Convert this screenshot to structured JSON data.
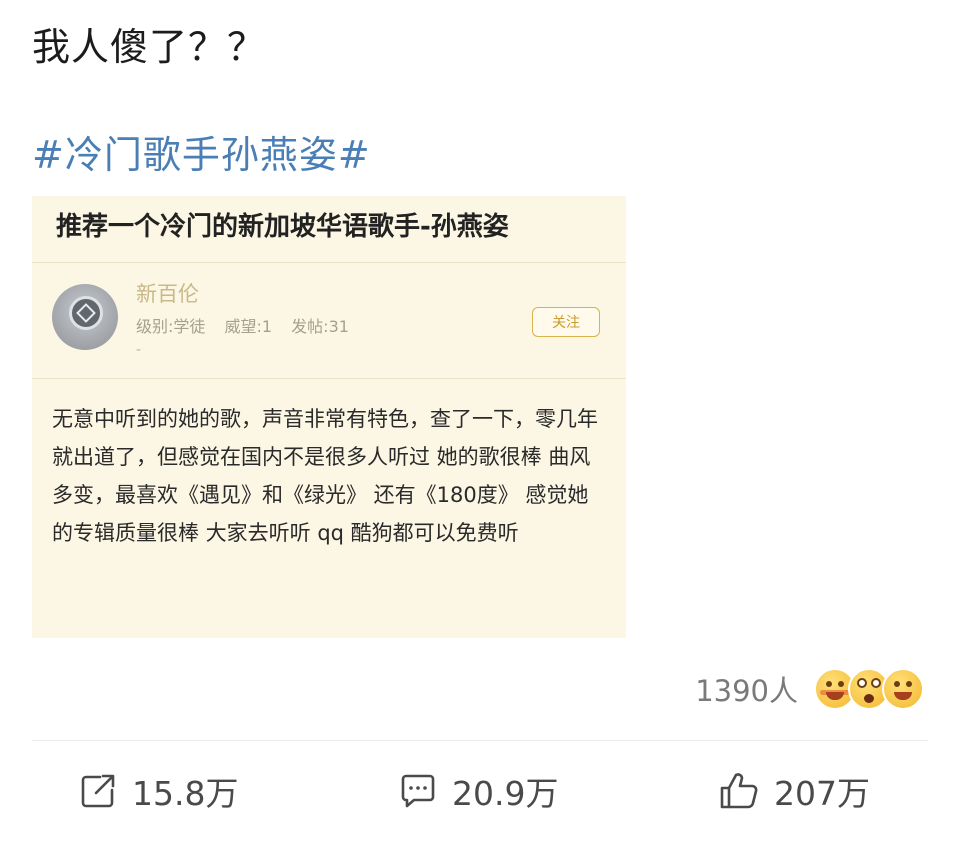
{
  "post": {
    "text": "我人傻了？？",
    "topic": "#冷门歌手孙燕姿#"
  },
  "card": {
    "title": "推荐一个冷门的新加坡华语歌手-孙燕姿",
    "user": {
      "name": "新百伦",
      "level": "级别:学徒",
      "prestige": "威望:1",
      "posts": "发帖:31",
      "dash": "-"
    },
    "follow_label": "关注",
    "body": "无意中听到的她的歌，声音非常有特色，查了一下，零几年就出道了，但感觉在国内不是很多人听过 她的歌很棒 曲风多变，最喜欢《遇见》和《绿光》 还有《180度》 感觉她的专辑质量很棒 大家去听听 qq 酷狗都可以免费听"
  },
  "reactions": {
    "count": "1390人",
    "emojis": [
      "laughing-blush-emoji",
      "shocked-emoji",
      "grin-emoji"
    ]
  },
  "actions": {
    "share": {
      "icon": "share-icon",
      "count": "15.8万"
    },
    "comment": {
      "icon": "comment-icon",
      "count": "20.9万"
    },
    "like": {
      "icon": "thumbs-up-icon",
      "count": "207万"
    }
  },
  "colors": {
    "topic": "#4a7fb5",
    "card_bg": "#fcf6e4",
    "follow_accent": "#d9b34b"
  }
}
